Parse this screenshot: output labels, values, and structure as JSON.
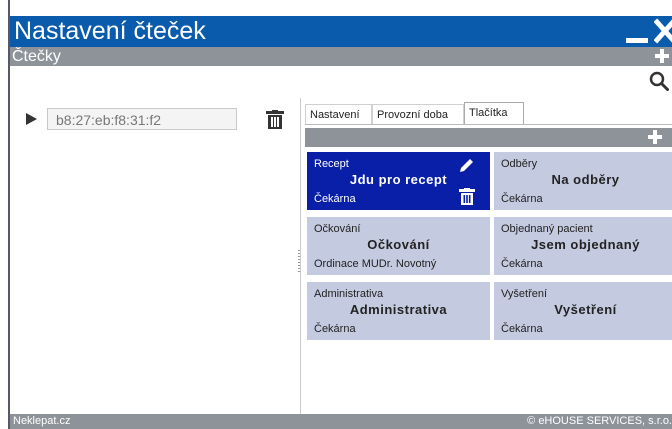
{
  "window": {
    "title": "Nastavení čteček",
    "section_title": "Čtečky",
    "colors": {
      "titlebar": "#0a5bab",
      "bar": "#8e9299",
      "card": "#c4cbe0",
      "card_selected": "#0a1fa8"
    }
  },
  "reader": {
    "mac": "b8:27:eb:f8:31:f2"
  },
  "tabs": [
    {
      "label": "Nastavení"
    },
    {
      "label": "Provozní doba"
    },
    {
      "label": "Tlačítka",
      "active": true
    }
  ],
  "buttons": [
    {
      "category": "Recept",
      "name": "Jdu pro recept",
      "location": "Čekárna",
      "selected": true
    },
    {
      "category": "Odběry",
      "name": "Na odběry",
      "location": "Čekárna"
    },
    {
      "category": "Očkování",
      "name": "Očkování",
      "location": "Ordinace MUDr. Novotný"
    },
    {
      "category": "Objednaný pacient",
      "name": "Jsem objednaný",
      "location": "Čekárna"
    },
    {
      "category": "Administrativa",
      "name": "Administrativa",
      "location": "Čekárna"
    },
    {
      "category": "Vyšetření",
      "name": "Vyšetření",
      "location": "Čekárna"
    }
  ],
  "footer": {
    "left": "Neklepat.cz",
    "right": "© eHOUSE SERVICES, s.r.o."
  },
  "icons": [
    "minimize-icon",
    "close-icon",
    "plus-icon",
    "search-icon",
    "play-icon",
    "trash-icon",
    "pencil-icon"
  ]
}
